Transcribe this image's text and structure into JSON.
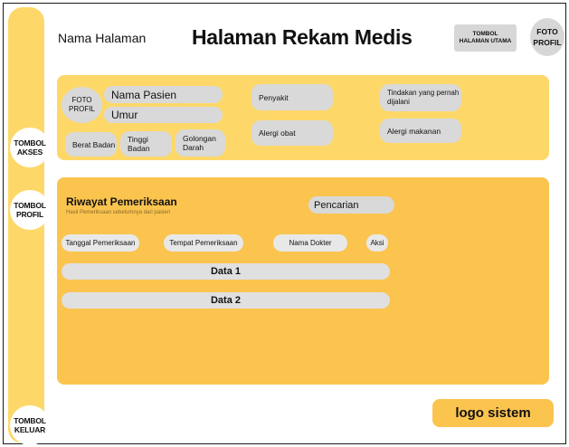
{
  "header": {
    "page_label": "Nama Halaman",
    "title": "Halaman Rekam Medis",
    "home_button": "TOMBOL\nHALAMAN UTAMA",
    "profile_photo": "FOTO\nPROFIL"
  },
  "sidebar": {
    "akses": "TOMBOL\nAKSES",
    "profil": "TOMBOL\nPROFIL",
    "keluar": "TOMBOL\nKELUAR"
  },
  "patient": {
    "photo": "FOTO\nPROFIL",
    "name": "Nama Pasien",
    "age": "Umur",
    "weight": "Berat Badan",
    "height": "Tinggi Badan",
    "blood_type": "Golongan\nDarah",
    "disease": "Penyakit",
    "drug_allergy": "Alergi obat",
    "procedures": "Tindakan yang pernah\ndijalani",
    "food_allergy": "Alergi makanan"
  },
  "history": {
    "title": "Riwayat Pemeriksaan",
    "subtitle": "Hasil Pemeriksaan sebelumnya dari pasien",
    "search": "Pencarian",
    "columns": [
      "Tanggal Pemeriksaan",
      "Tempat Pemeriksaan",
      "Nama Dokter",
      "Aksi"
    ],
    "rows": [
      "Data 1",
      "Data 2"
    ]
  },
  "footer": {
    "logo": "logo sistem"
  },
  "colors": {
    "sidebar": "#fdd869",
    "patient_card": "#fdd869",
    "history_card": "#fbc44f",
    "pill": "#d9d9d9"
  }
}
